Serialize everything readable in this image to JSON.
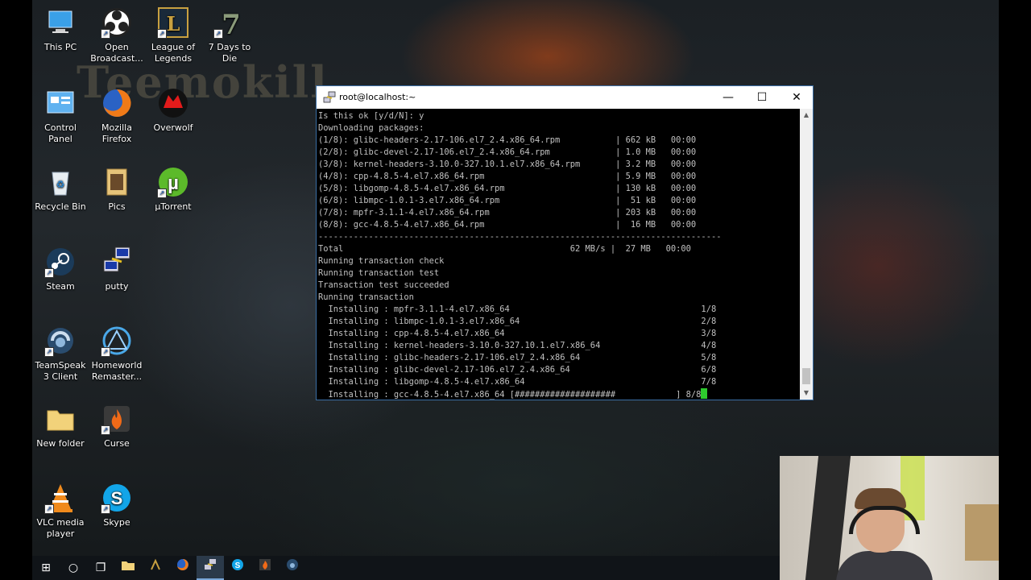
{
  "desktop_icons": [
    {
      "label": "This PC"
    },
    {
      "label": "Open Broadcast..."
    },
    {
      "label": "League of Legends"
    },
    {
      "label": "7 Days to Die"
    },
    {
      "label": "Control Panel"
    },
    {
      "label": "Mozilla Firefox"
    },
    {
      "label": "Overwolf"
    },
    {
      "label": "Recycle Bin"
    },
    {
      "label": "Pics"
    },
    {
      "label": "µTorrent"
    },
    {
      "label": "Steam"
    },
    {
      "label": "putty"
    },
    {
      "label": "TeamSpeak 3 Client"
    },
    {
      "label": "Homeworld Remaster..."
    },
    {
      "label": "New folder"
    },
    {
      "label": "Curse"
    },
    {
      "label": "VLC media player"
    },
    {
      "label": "Skype"
    }
  ],
  "terminal": {
    "title": "root@localhost:~",
    "lines": [
      "Is this ok [y/d/N]: y",
      "Downloading packages:",
      "(1/8): glibc-headers-2.17-106.el7_2.4.x86_64.rpm           | 662 kB   00:00",
      "(2/8): glibc-devel-2.17-106.el7_2.4.x86_64.rpm             | 1.0 MB   00:00",
      "(3/8): kernel-headers-3.10.0-327.10.1.el7.x86_64.rpm       | 3.2 MB   00:00",
      "(4/8): cpp-4.8.5-4.el7.x86_64.rpm                          | 5.9 MB   00:00",
      "(5/8): libgomp-4.8.5-4.el7.x86_64.rpm                      | 130 kB   00:00",
      "(6/8): libmpc-1.0.1-3.el7.x86_64.rpm                       |  51 kB   00:00",
      "(7/8): mpfr-3.1.1-4.el7.x86_64.rpm                         | 203 kB   00:00",
      "(8/8): gcc-4.8.5-4.el7.x86_64.rpm                          |  16 MB   00:00",
      "--------------------------------------------------------------------------------",
      "Total                                             62 MB/s |  27 MB   00:00",
      "Running transaction check",
      "Running transaction test",
      "Transaction test succeeded",
      "Running transaction",
      "  Installing : mpfr-3.1.1-4.el7.x86_64                                      1/8",
      "  Installing : libmpc-1.0.1-3.el7.x86_64                                    2/8",
      "  Installing : cpp-4.8.5-4.el7.x86_64                                       3/8",
      "  Installing : kernel-headers-3.10.0-327.10.1.el7.x86_64                    4/8",
      "  Installing : glibc-headers-2.17-106.el7_2.4.x86_64                        5/8",
      "  Installing : glibc-devel-2.17-106.el7_2.4.x86_64                          6/8",
      "  Installing : libgomp-4.8.5-4.el7.x86_64                                   7/8",
      "  Installing : gcc-4.8.5-4.el7.x86_64 [####################            ] 8/8"
    ]
  },
  "window_buttons": {
    "minimize": "—",
    "maximize": "☐",
    "close": "✕"
  },
  "taskbar": {
    "start": "⊞",
    "search": "○",
    "taskview": "❐",
    "apps": [
      "explorer-icon",
      "lol-icon",
      "firefox-icon",
      "putty-icon",
      "skype-icon",
      "curse-icon",
      "teamspeak-icon"
    ]
  },
  "colors": {
    "accent": "#3a6ea5",
    "terminal_bg": "#000000",
    "terminal_fg": "#c0c0c0",
    "cursor": "#2ecc2e"
  }
}
